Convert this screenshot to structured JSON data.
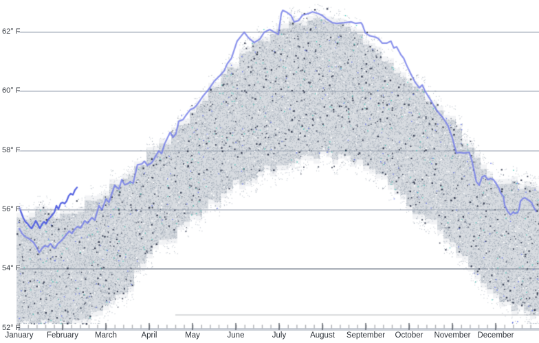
{
  "chart_data": {
    "type": "scatter",
    "title": "",
    "xlabel": "",
    "ylabel": "",
    "y_axis": {
      "unit": "°F",
      "tick_values": [
        62,
        60,
        58,
        56,
        54,
        52
      ],
      "tick_labels": [
        "62° F",
        "60° F",
        "58° F",
        "56° F",
        "54° F",
        "52° F"
      ],
      "visible_range_F": [
        52.0,
        63.0
      ],
      "grid": true
    },
    "x_axis": {
      "tick_labels": [
        "January",
        "February",
        "March",
        "April",
        "May",
        "June",
        "July",
        "August",
        "September",
        "October",
        "November",
        "December"
      ],
      "range_days": [
        0,
        365
      ],
      "minor_ticks_every_days": 6
    },
    "legend": {
      "visible": false
    },
    "series": [
      {
        "name": "historical-daily-scatter-band",
        "type": "scatter",
        "description": "dense speckled band of daily temperature readings; envelope given as (day, top °F, bottom °F)",
        "band": [
          [
            0,
            55.8,
            52.2
          ],
          [
            30,
            55.86,
            52.1
          ],
          [
            45,
            56.1,
            52.3
          ],
          [
            61,
            56.55,
            52.7
          ],
          [
            76,
            57.2,
            53.35
          ],
          [
            91,
            57.8,
            54.5
          ],
          [
            107,
            58.45,
            55.1
          ],
          [
            122,
            59.3,
            55.7
          ],
          [
            137,
            60.1,
            56.3
          ],
          [
            152,
            60.9,
            56.88
          ],
          [
            167,
            61.65,
            57.25
          ],
          [
            183,
            62.05,
            57.5
          ],
          [
            198,
            62.35,
            57.76
          ],
          [
            213,
            62.44,
            57.9
          ],
          [
            228,
            62.2,
            57.8
          ],
          [
            243,
            61.75,
            57.57
          ],
          [
            258,
            61.1,
            57.0
          ],
          [
            274,
            60.35,
            56.14
          ],
          [
            289,
            59.73,
            55.63
          ],
          [
            304,
            58.9,
            55.0
          ],
          [
            320,
            57.87,
            53.9
          ],
          [
            335,
            57.0,
            53.17
          ],
          [
            350,
            56.8,
            52.66
          ],
          [
            365,
            56.65,
            52.5
          ]
        ]
      },
      {
        "name": "full-year-daily-line",
        "type": "line",
        "points": [
          [
            0,
            55.37
          ],
          [
            2,
            55.2
          ],
          [
            4,
            55.1
          ],
          [
            6,
            55.05
          ],
          [
            8,
            54.98
          ],
          [
            10,
            54.9
          ],
          [
            12,
            54.75
          ],
          [
            14,
            54.56
          ],
          [
            16,
            54.7
          ],
          [
            18,
            54.79
          ],
          [
            20,
            54.75
          ],
          [
            22,
            54.86
          ],
          [
            24,
            54.72
          ],
          [
            25,
            54.7
          ],
          [
            27,
            54.85
          ],
          [
            30,
            54.98
          ],
          [
            32,
            55.1
          ],
          [
            35,
            55.28
          ],
          [
            37,
            55.2
          ],
          [
            39,
            55.35
          ],
          [
            41,
            55.44
          ],
          [
            43,
            55.38
          ],
          [
            46,
            55.63
          ],
          [
            48,
            55.55
          ],
          [
            51,
            55.74
          ],
          [
            53,
            55.65
          ],
          [
            56,
            56.14
          ],
          [
            58,
            56.0
          ],
          [
            61,
            56.37
          ],
          [
            63,
            56.25
          ],
          [
            67,
            56.83
          ],
          [
            70,
            56.7
          ],
          [
            72,
            57.02
          ],
          [
            74,
            56.85
          ],
          [
            76,
            56.88
          ],
          [
            78,
            56.95
          ],
          [
            80,
            56.9
          ],
          [
            83,
            57.52
          ],
          [
            86,
            57.55
          ],
          [
            88,
            57.64
          ],
          [
            90,
            57.5
          ],
          [
            93,
            57.59
          ],
          [
            95,
            57.75
          ],
          [
            98,
            57.99
          ],
          [
            100,
            57.9
          ],
          [
            102,
            58.22
          ],
          [
            106,
            58.62
          ],
          [
            108,
            58.45
          ],
          [
            110,
            58.57
          ],
          [
            112,
            58.99
          ],
          [
            115,
            59.05
          ],
          [
            117,
            59.19
          ],
          [
            120,
            59.38
          ],
          [
            123,
            59.45
          ],
          [
            125,
            59.56
          ],
          [
            129,
            59.84
          ],
          [
            133,
            60.07
          ],
          [
            137,
            60.35
          ],
          [
            141,
            60.54
          ],
          [
            144,
            60.7
          ],
          [
            146,
            60.93
          ],
          [
            149,
            61.12
          ],
          [
            153,
            61.7
          ],
          [
            156,
            61.88
          ],
          [
            158,
            62.0
          ],
          [
            161,
            61.81
          ],
          [
            165,
            61.65
          ],
          [
            169,
            61.77
          ],
          [
            172,
            62.0
          ],
          [
            176,
            62.09
          ],
          [
            180,
            61.98
          ],
          [
            182,
            61.93
          ],
          [
            184,
            62.63
          ],
          [
            185,
            62.74
          ],
          [
            188,
            62.67
          ],
          [
            191,
            62.56
          ],
          [
            193,
            62.35
          ],
          [
            196,
            62.39
          ],
          [
            199,
            62.58
          ],
          [
            203,
            62.63
          ],
          [
            206,
            62.69
          ],
          [
            210,
            62.63
          ],
          [
            213,
            62.56
          ],
          [
            216,
            62.44
          ],
          [
            220,
            62.32
          ],
          [
            223,
            62.3
          ],
          [
            228,
            62.32
          ],
          [
            233,
            62.35
          ],
          [
            236,
            62.3
          ],
          [
            240,
            62.32
          ],
          [
            241,
            62.25
          ],
          [
            243,
            61.98
          ],
          [
            246,
            61.88
          ],
          [
            250,
            61.84
          ],
          [
            252,
            61.79
          ],
          [
            255,
            61.63
          ],
          [
            258,
            61.63
          ],
          [
            261,
            61.7
          ],
          [
            263,
            61.47
          ],
          [
            265,
            61.51
          ],
          [
            268,
            61.24
          ],
          [
            270,
            61.12
          ],
          [
            272,
            60.89
          ],
          [
            275,
            60.59
          ],
          [
            278,
            60.31
          ],
          [
            281,
            60.12
          ],
          [
            283,
            60.22
          ],
          [
            285,
            60.01
          ],
          [
            288,
            59.78
          ],
          [
            292,
            59.45
          ],
          [
            294,
            59.31
          ],
          [
            298,
            59.08
          ],
          [
            301,
            58.85
          ],
          [
            304,
            58.45
          ],
          [
            307,
            57.92
          ],
          [
            309,
            57.94
          ],
          [
            312,
            57.92
          ],
          [
            316,
            57.94
          ],
          [
            318,
            57.64
          ],
          [
            320,
            57.18
          ],
          [
            321,
            56.95
          ],
          [
            323,
            56.83
          ],
          [
            325,
            57.11
          ],
          [
            327,
            57.16
          ],
          [
            329,
            57.02
          ],
          [
            331,
            57.06
          ],
          [
            333,
            57.02
          ],
          [
            335,
            56.88
          ],
          [
            337,
            56.72
          ],
          [
            338,
            56.58
          ],
          [
            340,
            56.44
          ],
          [
            341,
            56.14
          ],
          [
            343,
            55.95
          ],
          [
            345,
            55.83
          ],
          [
            347,
            55.93
          ],
          [
            348,
            55.88
          ],
          [
            350,
            55.9
          ],
          [
            351,
            56.02
          ],
          [
            352,
            56.3
          ],
          [
            354,
            56.39
          ],
          [
            355,
            56.41
          ],
          [
            357,
            56.34
          ],
          [
            358,
            56.32
          ],
          [
            360,
            56.23
          ],
          [
            361,
            56.11
          ],
          [
            363,
            55.95
          ]
        ]
      },
      {
        "name": "recent-daily-line",
        "type": "line",
        "points": [
          [
            0,
            56.09
          ],
          [
            1.4,
            55.91
          ],
          [
            2.9,
            55.72
          ],
          [
            4.3,
            55.6
          ],
          [
            5.8,
            55.53
          ],
          [
            7.2,
            55.44
          ],
          [
            8.7,
            55.37
          ],
          [
            10.1,
            55.49
          ],
          [
            11.6,
            55.63
          ],
          [
            13,
            55.51
          ],
          [
            14.5,
            55.37
          ],
          [
            15.9,
            55.51
          ],
          [
            17.4,
            55.6
          ],
          [
            18.8,
            55.53
          ],
          [
            20.3,
            55.67
          ],
          [
            21.7,
            55.74
          ],
          [
            23.2,
            55.83
          ],
          [
            24.6,
            55.91
          ],
          [
            26.1,
            56.14
          ],
          [
            27.5,
            56.02
          ],
          [
            29,
            56.21
          ],
          [
            30.4,
            56.25
          ],
          [
            31.9,
            56.21
          ],
          [
            33.3,
            56.3
          ],
          [
            34.8,
            56.48
          ],
          [
            36.2,
            56.55
          ],
          [
            37.7,
            56.51
          ],
          [
            39.1,
            56.67
          ],
          [
            40.6,
            56.76
          ]
        ]
      }
    ],
    "colors": {
      "full_year_line": "rgba(112,122,232,0.82)",
      "recent_line": "rgba(80,94,224,0.95)",
      "scatter_wash": "rgba(170,178,190,0.38)",
      "scatter_wash_fringe": "rgba(172,180,192,0.16)",
      "scatter_dot": "rgba(125,138,155,0.6)",
      "scatter_dot_white": "rgba(255,255,255,0.95)",
      "scatter_dot_dark": "rgba(25,32,55,0.8)",
      "scatter_dot_teal": "rgba(70,200,185,0.9)",
      "scatter_dot_blue": "rgba(90,105,230,0.9)",
      "gridline": "#c9ced6",
      "gridline_54": "#a7adb6",
      "baseline_faint": "rgba(95,100,110,0.4)",
      "tick": "rgba(60,66,76,0.6)",
      "minor_tick": "rgba(70,75,85,0.45)",
      "label_text": "#363b42"
    }
  }
}
